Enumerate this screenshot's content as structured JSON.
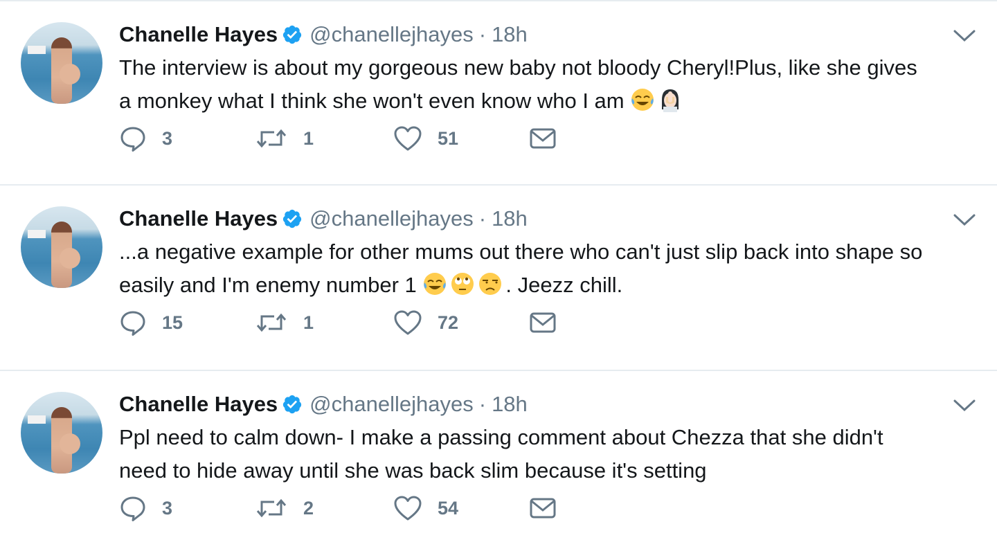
{
  "tweets": [
    {
      "name": "Chanelle Hayes",
      "handle": "@chanellejhayes",
      "separator": "·",
      "time": "18h",
      "text_parts": [
        "The interview is about my gorgeous new baby not bloody Cheryl!Plus, like she gives a monkey what I think she won't even know who I am "
      ],
      "emojis": [
        "face-with-tears-of-joy",
        "woman-facepalming"
      ],
      "text_after": "",
      "replies": "3",
      "retweets": "1",
      "likes": "51"
    },
    {
      "name": "Chanelle Hayes",
      "handle": "@chanellejhayes",
      "separator": "·",
      "time": "18h",
      "text_parts": [
        "...a negative example for other mums out there who can't just slip back into shape so easily and I'm enemy number 1 "
      ],
      "emojis": [
        "face-with-tears-of-joy",
        "face-with-rolling-eyes",
        "unamused-face"
      ],
      "text_after": ". Jeezz chill.",
      "replies": "15",
      "retweets": "1",
      "likes": "72"
    },
    {
      "name": "Chanelle Hayes",
      "handle": "@chanellejhayes",
      "separator": "·",
      "time": "18h",
      "text_parts": [
        "Ppl need to calm down- I make a passing comment about Chezza that she didn't need to hide away until she was back slim because it's setting"
      ],
      "emojis": [],
      "text_after": "",
      "replies": "3",
      "retweets": "2",
      "likes": "54"
    }
  ],
  "colors": {
    "text": "#14171a",
    "muted": "#657786",
    "verified": "#1da1f2",
    "divider": "#e6ecf0"
  },
  "icons": {
    "reply": "reply-icon",
    "retweet": "retweet-icon",
    "like": "heart-icon",
    "dm": "envelope-icon",
    "verified": "verified-badge-icon",
    "menu": "chevron-down-icon"
  }
}
